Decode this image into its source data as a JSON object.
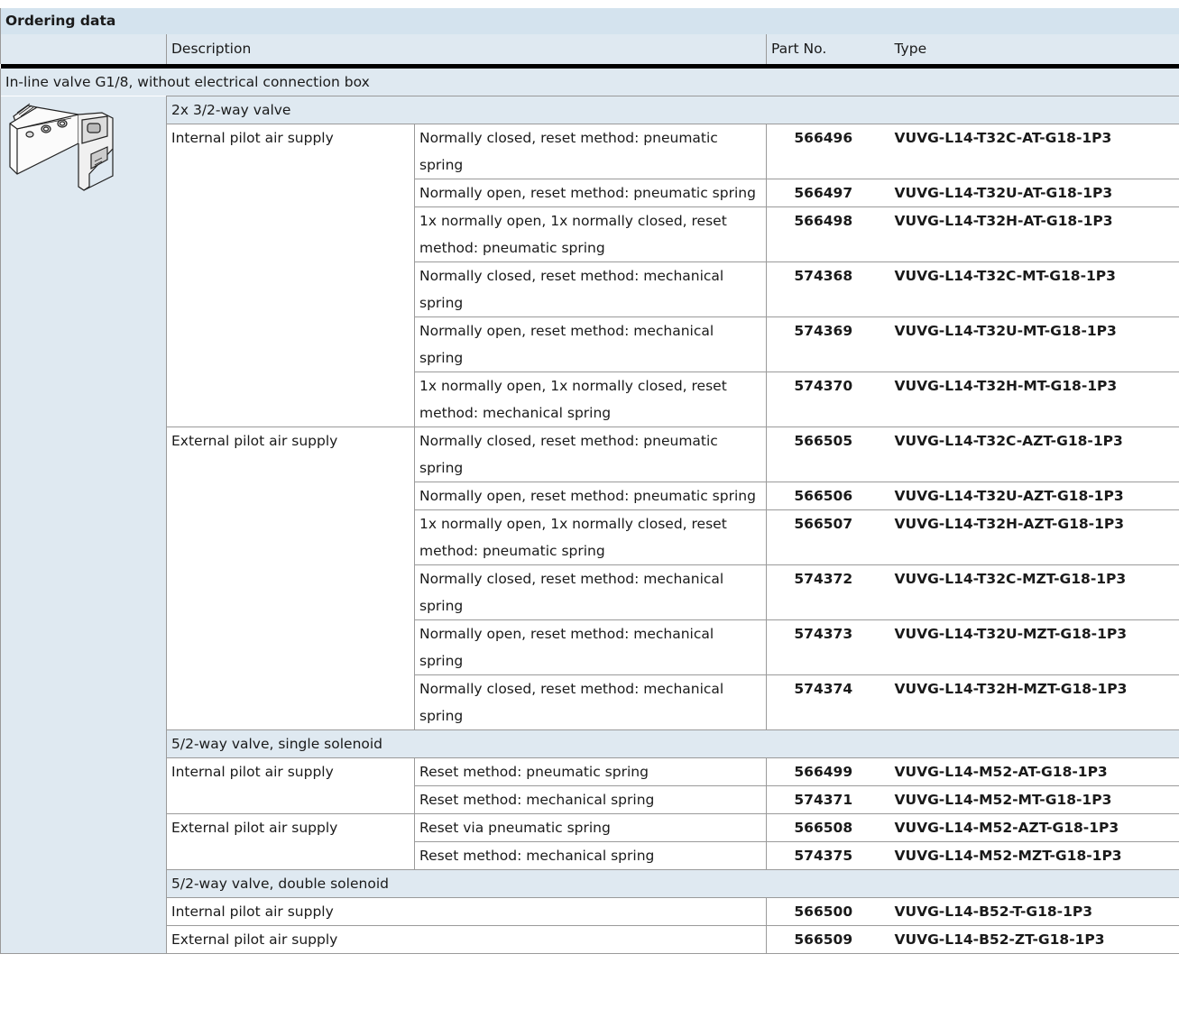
{
  "title": "Ordering data",
  "columns": {
    "description": "Description",
    "part_no": "Part No.",
    "type": "Type"
  },
  "group": "In-line valve G1/8, without electrical connection box",
  "section_2x32": {
    "label": "2x 3/2-way valve",
    "internal": {
      "label": "Internal pilot air supply",
      "rows": [
        {
          "desc": "Normally closed, reset method: pneumatic spring",
          "part": "566496",
          "type": "VUVG-L14-T32C-AT-G18-1P3"
        },
        {
          "desc": "Normally open, reset method: pneumatic spring",
          "part": "566497",
          "type": "VUVG-L14-T32U-AT-G18-1P3"
        },
        {
          "desc": "1x normally open, 1x normally closed, reset method: pneumatic spring",
          "part": "566498",
          "type": "VUVG-L14-T32H-AT-G18-1P3"
        },
        {
          "desc": "Normally closed, reset method: mechanical spring",
          "part": "574368",
          "type": "VUVG-L14-T32C-MT-G18-1P3"
        },
        {
          "desc": "Normally open, reset method: mechanical spring",
          "part": "574369",
          "type": "VUVG-L14-T32U-MT-G18-1P3"
        },
        {
          "desc": "1x normally open, 1x normally closed, reset method: mechanical spring",
          "part": "574370",
          "type": "VUVG-L14-T32H-MT-G18-1P3"
        }
      ]
    },
    "external": {
      "label": "External pilot air supply",
      "rows": [
        {
          "desc": "Normally closed, reset method: pneumatic spring",
          "part": "566505",
          "type": "VUVG-L14-T32C-AZT-G18-1P3"
        },
        {
          "desc": "Normally open, reset method: pneumatic spring",
          "part": "566506",
          "type": "VUVG-L14-T32U-AZT-G18-1P3"
        },
        {
          "desc": "1x normally open, 1x normally closed, reset method: pneumatic spring",
          "part": "566507",
          "type": "VUVG-L14-T32H-AZT-G18-1P3"
        },
        {
          "desc": "Normally closed, reset method: mechanical spring",
          "part": "574372",
          "type": "VUVG-L14-T32C-MZT-G18-1P3"
        },
        {
          "desc": "Normally open, reset method: mechanical spring",
          "part": "574373",
          "type": "VUVG-L14-T32U-MZT-G18-1P3"
        },
        {
          "desc": "Normally closed, reset method: mechanical spring",
          "part": "574374",
          "type": "VUVG-L14-T32H-MZT-G18-1P3"
        }
      ]
    }
  },
  "section_52single": {
    "label": "5/2-way valve, single solenoid",
    "internal": {
      "label": "Internal pilot air supply",
      "rows": [
        {
          "desc": "Reset method: pneumatic spring",
          "part": "566499",
          "type": "VUVG-L14-M52-AT-G18-1P3"
        },
        {
          "desc": "Reset method: mechanical spring",
          "part": "574371",
          "type": "VUVG-L14-M52-MT-G18-1P3"
        }
      ]
    },
    "external": {
      "label": "External pilot air supply",
      "rows": [
        {
          "desc": "Reset via pneumatic spring",
          "part": "566508",
          "type": "VUVG-L14-M52-AZT-G18-1P3"
        },
        {
          "desc": "Reset method: mechanical spring",
          "part": "574375",
          "type": "VUVG-L14-M52-MZT-G18-1P3"
        }
      ]
    }
  },
  "section_52double": {
    "label": "5/2-way valve, double solenoid",
    "rows": [
      {
        "desc": "Internal pilot air supply",
        "part": "566500",
        "type": "VUVG-L14-B52-T-G18-1P3"
      },
      {
        "desc": "External pilot air supply",
        "part": "566509",
        "type": "VUVG-L14-B52-ZT-G18-1P3"
      }
    ]
  }
}
